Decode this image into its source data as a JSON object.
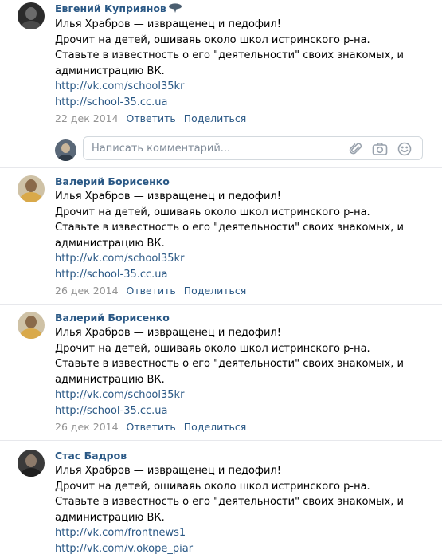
{
  "posts": [
    {
      "author": "Евгений Куприянов",
      "lines": [
        "Илья Храбров — извращенец и педофил!",
        "Дрочит на детей, ошиваяь около школ истринского р-на.",
        "Ставьте в известность о его \"деятельности\" своих знакомых, и",
        "администрацию ВК."
      ],
      "links": [
        "http://vk.com/school35kr",
        "http://school-35.cc.ua"
      ],
      "date": "22 дек 2014",
      "reply": "Ответить",
      "share": "Поделиться"
    },
    {
      "author": "Валерий Борисенко",
      "lines": [
        "Илья Храбров — извращенец и педофил!",
        "Дрочит на детей, ошиваяь около школ истринского р-на.",
        "Ставьте в известность о его \"деятельности\" своих знакомых, и",
        "администрацию ВК."
      ],
      "links": [
        "http://vk.com/school35kr",
        "http://school-35.cc.ua"
      ],
      "date": "26 дек 2014",
      "reply": "Ответить",
      "share": "Поделиться"
    },
    {
      "author": "Валерий Борисенко",
      "lines": [
        "Илья Храбров — извращенец и педофил!",
        "Дрочит на детей, ошиваяь около школ истринского р-на.",
        "Ставьте в известность о его \"деятельности\" своих знакомых, и",
        "администрацию ВК."
      ],
      "links": [
        "http://vk.com/school35kr",
        "http://school-35.cc.ua"
      ],
      "date": "26 дек 2014",
      "reply": "Ответить",
      "share": "Поделиться"
    },
    {
      "author": "Стас Бадров",
      "lines": [
        "Илья Храбров — извращенец и педофил!",
        "Дрочит на детей, ошиваяь около школ истринского р-на.",
        "Ставьте в известность о его \"деятельности\" своих знакомых, и",
        "администрацию ВК."
      ],
      "links": [
        "http://vk.com/frontnews1",
        "http://vk.com/v.okope_piar"
      ]
    }
  ],
  "comment": {
    "placeholder": "Написать комментарий..."
  },
  "icons": {
    "author_badge": "profile-badge-icon",
    "attach": "paperclip-icon",
    "camera": "camera-icon",
    "emoji": "smile-icon"
  },
  "colors": {
    "link": "#2a5885",
    "meta": "#939393",
    "separator": "#e7e8ec",
    "input_border": "#d3d9de",
    "icon": "#99a2ad"
  }
}
